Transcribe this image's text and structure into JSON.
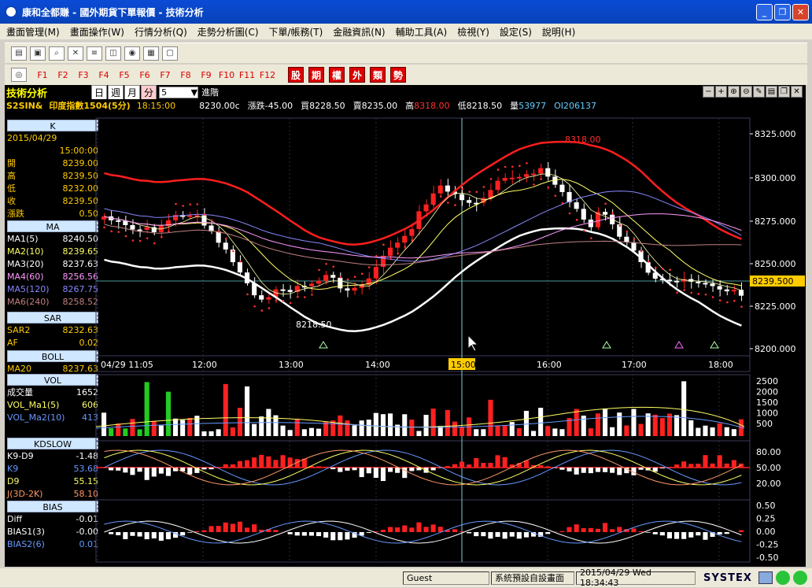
{
  "window": {
    "title": "康和全都賺 - 國外期貨下單報價 - 技術分析"
  },
  "menu": [
    "畫面管理(M)",
    "畫面操作(W)",
    "行情分析(Q)",
    "走勢分析圖(C)",
    "下單/帳務(T)",
    "金融資訊(N)",
    "輔助工具(A)",
    "檢視(Y)",
    "設定(S)",
    "說明(H)"
  ],
  "fkeys": [
    "F1",
    "F2",
    "F3",
    "F4",
    "F5",
    "F6",
    "F7",
    "F8",
    "F9",
    "F10",
    "F11",
    "F12"
  ],
  "redkeys": [
    "股",
    "期",
    "權",
    "外",
    "類",
    "勢"
  ],
  "tabbar": {
    "label": "技術分析",
    "periods": [
      "日",
      "週",
      "月",
      "分"
    ],
    "active": "分",
    "interval": "5",
    "jinjie": "進階"
  },
  "quote": {
    "symbol": "S2SIN&",
    "name": "印度指數1504(5分)",
    "time": "18:15:00",
    "last": "8230.00c",
    "change_label": "漲跌",
    "change": "-45.00",
    "bid_label": "買",
    "bid": "8228.50",
    "ask_label": "賣",
    "ask": "8235.00",
    "high_label": "高",
    "high": "8318.00",
    "low_label": "低",
    "low": "8218.50",
    "vol_label": "量",
    "vol": "53977",
    "oi_label": "OI",
    "oi": "206137"
  },
  "side": {
    "k": {
      "head": "K",
      "date": "2015/04/29",
      "time": "15:00:00",
      "rows": [
        {
          "l": "開",
          "v": "8239.00"
        },
        {
          "l": "高",
          "v": "8239.50"
        },
        {
          "l": "低",
          "v": "8232.00"
        },
        {
          "l": "收",
          "v": "8239.50"
        },
        {
          "l": "漲跌",
          "v": "0.50"
        }
      ]
    },
    "ma": {
      "head": "MA",
      "rows": [
        {
          "l": "MA1(5)",
          "v": "8240.50",
          "c": "#ffffff"
        },
        {
          "l": "MA2(10)",
          "v": "8239.65",
          "c": "#ffff66"
        },
        {
          "l": "MA3(20)",
          "v": "8237.63",
          "c": "#ffffff"
        },
        {
          "l": "MA4(60)",
          "v": "8256.56",
          "c": "#ff99ff"
        },
        {
          "l": "MA5(120)",
          "v": "8267.75",
          "c": "#8888ff"
        },
        {
          "l": "MA6(240)",
          "v": "8258.52",
          "c": "#c08080"
        }
      ]
    },
    "sar": {
      "head": "SAR",
      "rows": [
        {
          "l": "SAR2",
          "v": "8232.63"
        },
        {
          "l": "AF",
          "v": "0.02"
        }
      ]
    },
    "boll": {
      "head": "BOLL",
      "rows": [
        {
          "l": "MA20",
          "v": "8237.63"
        }
      ]
    },
    "vol": {
      "head": "VOL",
      "rows": [
        {
          "l": "成交量",
          "v": "1652",
          "c": "#ffffff"
        },
        {
          "l": "VOL_Ma1(5)",
          "v": "606",
          "c": "#ffff66"
        },
        {
          "l": "VOL_Ma2(10)",
          "v": "413",
          "c": "#6699ff"
        }
      ]
    },
    "kd": {
      "head": "KDSLOW",
      "rows": [
        {
          "l": "K9-D9",
          "v": "-1.48",
          "c": "#ffffff"
        },
        {
          "l": "K9",
          "v": "53.68",
          "c": "#6699ff"
        },
        {
          "l": "D9",
          "v": "55.15",
          "c": "#ffff66"
        },
        {
          "l": "J(3D-2K)",
          "v": "58.10",
          "c": "#ff9966"
        }
      ]
    },
    "bias": {
      "head": "BIAS",
      "rows": [
        {
          "l": "Diff",
          "v": "-0.01",
          "c": "#ffffff"
        },
        {
          "l": "BIAS1(3)",
          "v": "-0.00",
          "c": "#ffffff"
        },
        {
          "l": "BIAS2(6)",
          "v": "0.01",
          "c": "#6699ff"
        }
      ]
    }
  },
  "axes": {
    "price_ticks": [
      "8325.000",
      "8300.000",
      "8275.000",
      "8250.000",
      "8225.000",
      "8200.000"
    ],
    "current_price": "8239.500",
    "time_ticks": [
      "04/29 11:05",
      "12:00",
      "13:00",
      "14:00",
      "15:00",
      "16:00",
      "17:00",
      "18:00"
    ],
    "vol_ticks": [
      "2500",
      "2000",
      "1500",
      "1000",
      "500"
    ],
    "kd_ticks": [
      "80.00",
      "50.00",
      "20.00"
    ],
    "bias_ticks": [
      "0.50",
      "0.25",
      "0.00",
      "-0.25",
      "-0.50"
    ],
    "hi_label": "8318.00",
    "lo_label": "8218.50"
  },
  "status": {
    "user": "Guest",
    "layout": "系統預設自設畫面",
    "clock": "2015/04/29 Wed 18:34:43",
    "brand": "SYSTEX"
  },
  "colors": {
    "up": "#ff2020",
    "down": "#ffffff",
    "bg": "#000000",
    "accent": "#ffcc00"
  }
}
